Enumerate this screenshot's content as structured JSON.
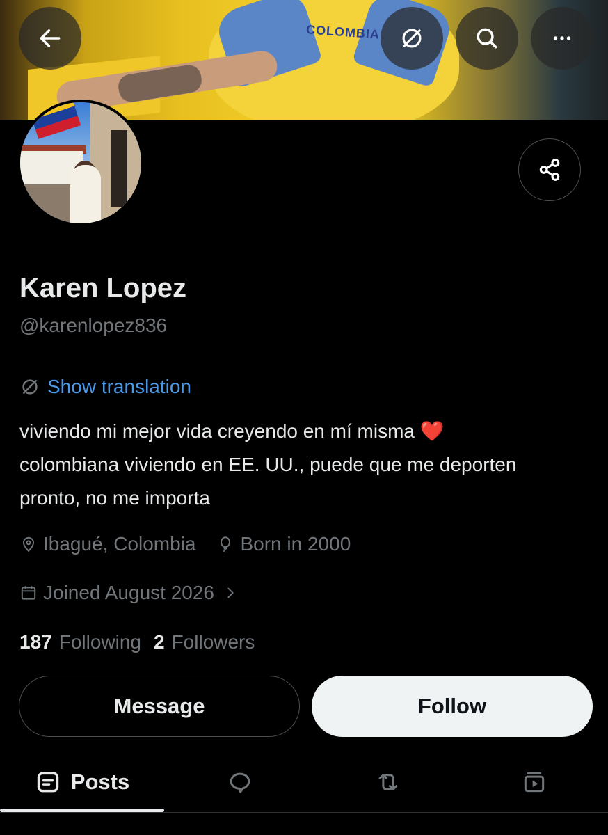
{
  "profile": {
    "name": "Karen Lopez",
    "handle": "@karenlopez836",
    "translate_label": "Show translation",
    "bio_lines": [
      "viviendo mi mejor vida creyendo en mí misma ❤️",
      "colombiana viviendo en EE. UU., puede que me deporten",
      "pronto, no me importa"
    ],
    "location": "Ibagué, Colombia",
    "birth": "Born in 2000",
    "joined": "Joined August 2026",
    "following_count": "187",
    "following_label": "Following",
    "followers_count": "2",
    "followers_label": "Followers"
  },
  "banner": {
    "shirt_text": "COLOMBIA"
  },
  "actions": {
    "message_label": "Message",
    "follow_label": "Follow"
  },
  "tabs": [
    {
      "label": "Posts",
      "icon": "posts-icon",
      "active": true
    },
    {
      "label": "",
      "icon": "replies-icon"
    },
    {
      "label": "",
      "icon": "reposts-icon"
    },
    {
      "label": "",
      "icon": "media-icon"
    }
  ],
  "header_icons": [
    "back-arrow-icon",
    "translate-icon",
    "search-icon",
    "more-icon"
  ],
  "colors": {
    "background": "#000000",
    "link": "#4a99e9",
    "muted": "#71767b",
    "text": "#e7e9ea",
    "follow_bg": "#eff3f4"
  }
}
